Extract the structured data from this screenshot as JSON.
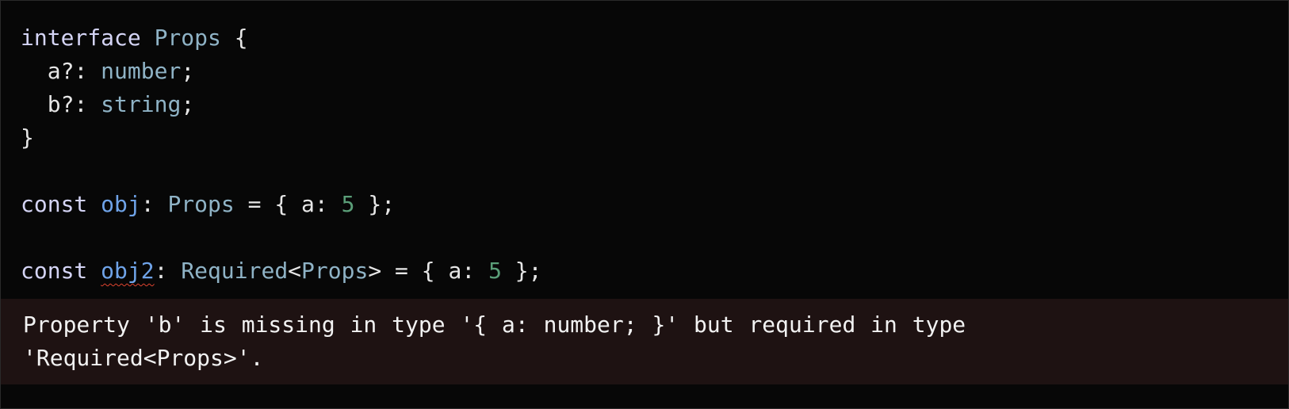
{
  "code": {
    "interface_kw": "interface",
    "interface_name": "Props",
    "open_brace": "{",
    "prop_a": "a?",
    "prop_a_colon": ":",
    "prop_a_type": "number",
    "prop_a_semi": ";",
    "prop_b": "b?",
    "prop_b_colon": ":",
    "prop_b_type": "string",
    "prop_b_semi": ";",
    "close_brace": "}",
    "const1_kw": "const",
    "const1_name": "obj",
    "const1_colon": ":",
    "const1_type": "Props",
    "const1_assign": "=",
    "const1_open": "{",
    "const1_key": "a:",
    "const1_val": "5",
    "const1_close": "};",
    "const2_kw": "const",
    "const2_name": "obj2",
    "const2_colon": ":",
    "const2_type_generic": "Required",
    "const2_lt": "<",
    "const2_type_param": "Props",
    "const2_gt": ">",
    "const2_assign": "=",
    "const2_open": "{",
    "const2_key": "a:",
    "const2_val": "5",
    "const2_close": "};"
  },
  "error": {
    "message": "Property 'b' is missing in type '{ a: number; }' but required in type 'Required<Props>'."
  },
  "colors": {
    "background": "#070707",
    "keyword": "#d4d4f5",
    "type": "#8fb3c6",
    "variable": "#6fa3e8",
    "number": "#5a9e78",
    "error_underline": "#e0442f",
    "error_panel": "#1e1212"
  }
}
